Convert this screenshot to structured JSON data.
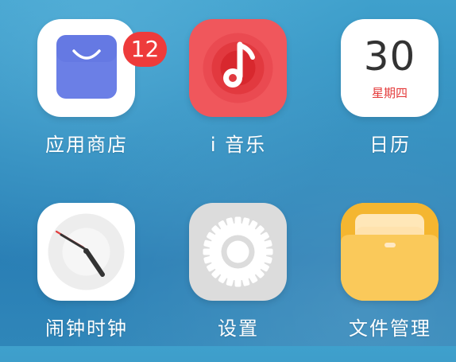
{
  "home_screen": {
    "apps": [
      {
        "label": "应用商店",
        "icon": "shopping-bag-icon",
        "badge": "12"
      },
      {
        "label": "i 音乐",
        "icon": "music-note-icon"
      },
      {
        "label": "日历",
        "icon": "calendar-icon",
        "day": "30",
        "weekday": "星期四"
      },
      {
        "label": "闹钟时钟",
        "icon": "clock-icon"
      },
      {
        "label": "设置",
        "icon": "gear-icon"
      },
      {
        "label": "文件管理",
        "icon": "folder-icon"
      }
    ]
  },
  "colors": {
    "badge": "#ee3b3b",
    "music": "#f0575c",
    "store_bag": "#6b7fe6",
    "folder": "#f6c444",
    "calendar_weekday": "#e43b3b"
  }
}
